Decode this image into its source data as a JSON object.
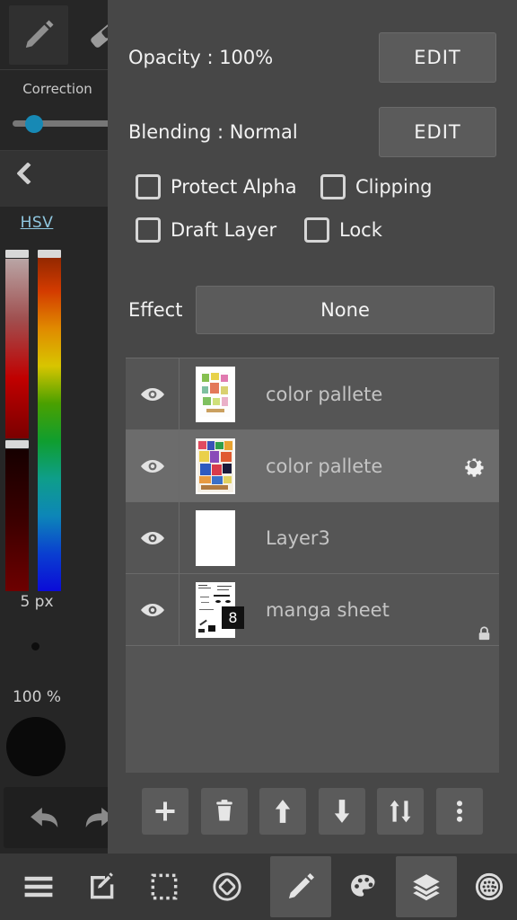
{
  "app": {
    "name": "ibisPaint layers panel",
    "panel_bg": "#474747",
    "sidebar_bg": "#262626",
    "list_bg": "#555555",
    "selected_row_bg": "#6c6c6c",
    "accent_slider": "#1789b5",
    "hsv_label_color": "#8fc7e0"
  },
  "sidebar": {
    "tools": [
      {
        "name": "pencil-tool",
        "icon": "pencil-icon",
        "selected": true
      },
      {
        "name": "eraser-tool",
        "icon": "eraser-icon",
        "selected": false
      }
    ],
    "correction": {
      "label": "Correction",
      "value_pct": 12
    },
    "collapse": {
      "icon": "chevron-left-icon"
    },
    "color_picker": {
      "mode_label": "HSV",
      "saturation_thumb_pct": 2,
      "value_thumb_pct": 56
    },
    "brush_size": "5 px",
    "brush_opacity": "100 %",
    "history": {
      "undo_label": "undo-icon",
      "redo_label": "redo-icon"
    }
  },
  "properties": {
    "opacity_label": "Opacity : 100%",
    "opacity_edit": "EDIT",
    "blending_label": "Blending : Normal",
    "blending_edit": "EDIT",
    "checkboxes": [
      {
        "id": "protect-alpha",
        "label": "Protect Alpha",
        "checked": false
      },
      {
        "id": "clipping",
        "label": "Clipping",
        "checked": false
      },
      {
        "id": "draft-layer",
        "label": "Draft Layer",
        "checked": false
      },
      {
        "id": "lock",
        "label": "Lock",
        "checked": false
      }
    ],
    "effect_label": "Effect",
    "effect_value": "None"
  },
  "layers": [
    {
      "name": "color pallete",
      "visible": true,
      "selected": false,
      "thumb": "color-artwork-light",
      "badge": null,
      "locked": false,
      "gear": false
    },
    {
      "name": "color pallete",
      "visible": true,
      "selected": true,
      "thumb": "color-artwork-vivid",
      "badge": null,
      "locked": false,
      "gear": true
    },
    {
      "name": "Layer3",
      "visible": true,
      "selected": false,
      "thumb": "blank-white",
      "badge": null,
      "locked": false,
      "gear": false
    },
    {
      "name": "manga sheet",
      "visible": true,
      "selected": false,
      "thumb": "manga-lineart",
      "badge": "8",
      "locked": true,
      "gear": false
    }
  ],
  "layer_actions": [
    {
      "id": "add-layer",
      "icon": "plus-icon"
    },
    {
      "id": "delete-layer",
      "icon": "trash-icon"
    },
    {
      "id": "move-layer-up",
      "icon": "arrow-up-icon"
    },
    {
      "id": "move-layer-down",
      "icon": "arrow-down-icon"
    },
    {
      "id": "merge-layers",
      "icon": "arrow-up-down-icon"
    },
    {
      "id": "layer-more-menu",
      "icon": "more-vertical-icon"
    }
  ],
  "bottom_nav": {
    "left_items": [
      {
        "id": "menu",
        "icon": "hamburger-menu-icon",
        "active": false
      },
      {
        "id": "edit-canvas",
        "icon": "edit-square-icon",
        "active": false
      },
      {
        "id": "selection",
        "icon": "dashed-select-icon",
        "active": false
      },
      {
        "id": "rotate",
        "icon": "rotate-canvas-icon",
        "active": false
      }
    ],
    "right_items": [
      {
        "id": "brush",
        "icon": "pencil-icon",
        "active": true
      },
      {
        "id": "palette",
        "icon": "palette-icon",
        "active": false
      },
      {
        "id": "layers",
        "icon": "layers-icon",
        "active": true
      },
      {
        "id": "filters",
        "icon": "filter-grid-icon",
        "active": false
      }
    ]
  }
}
